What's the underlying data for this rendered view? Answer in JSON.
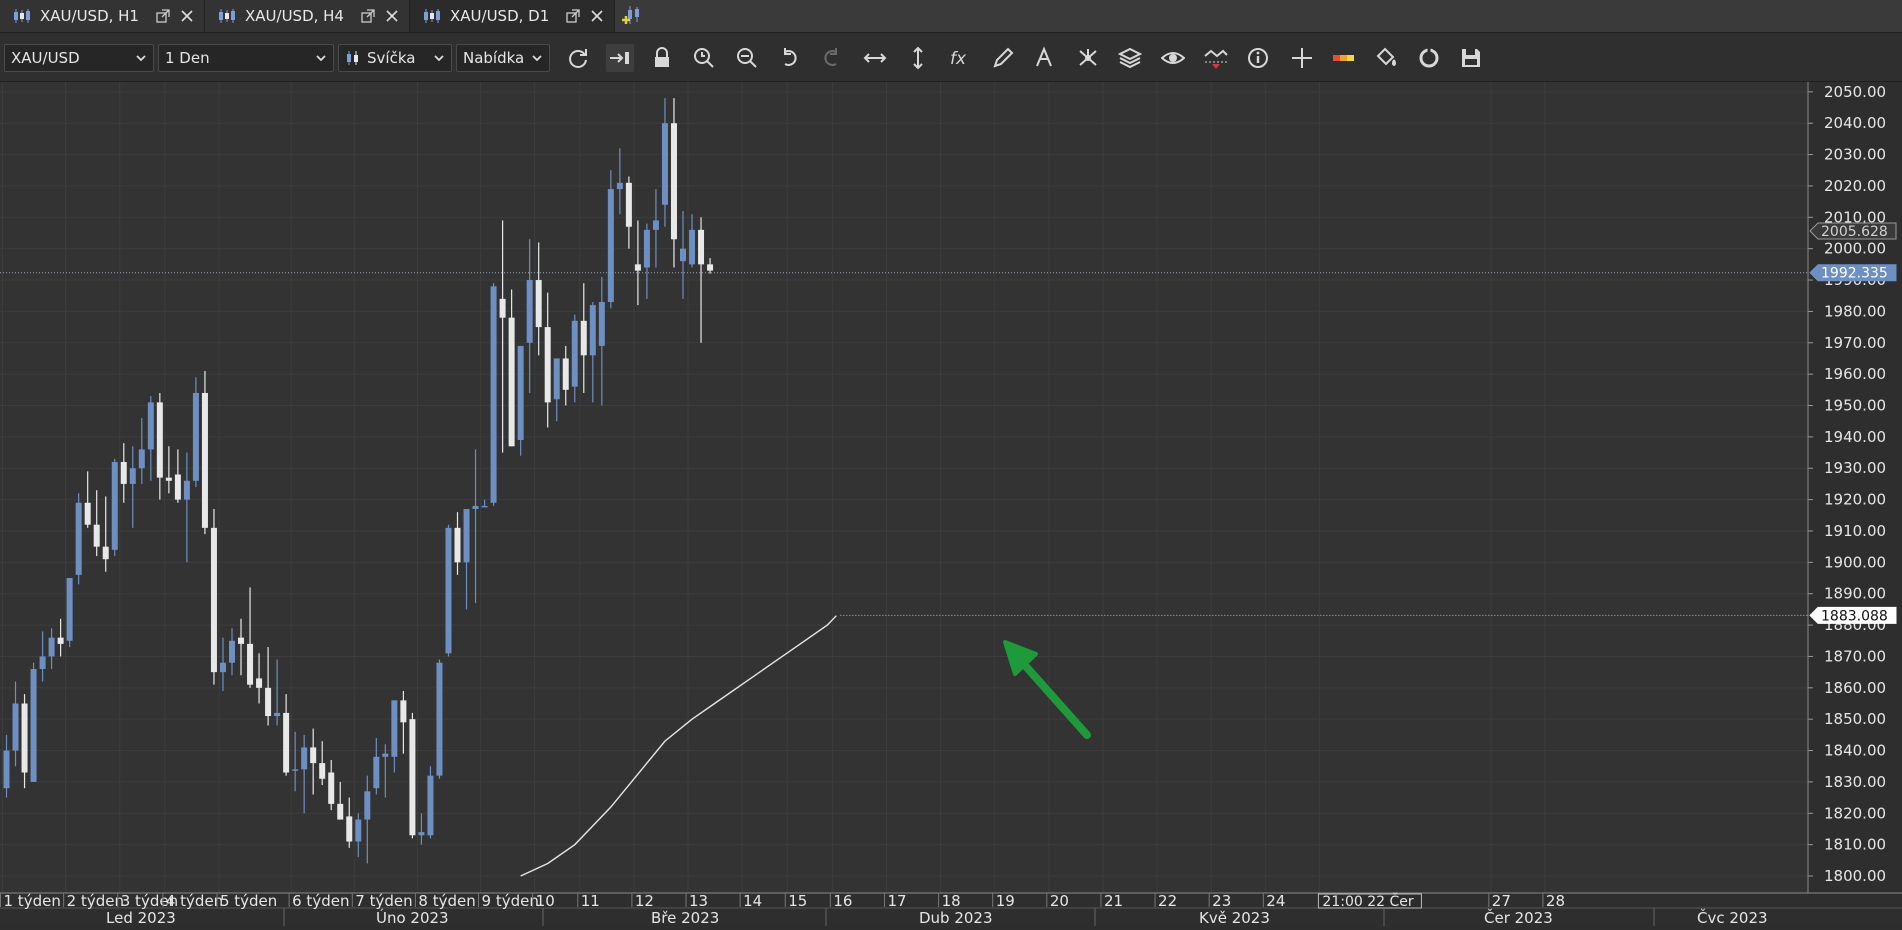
{
  "tabs": [
    {
      "label": "XAU/USD, H1",
      "active": false
    },
    {
      "label": "XAU/USD, H4",
      "active": false
    },
    {
      "label": "XAU/USD, D1",
      "active": true
    }
  ],
  "toolbar": {
    "instrument": "XAU/USD",
    "period": "1 Den",
    "chart_type": "Svíčka",
    "price_side": "Nabídka",
    "tools": [
      "refresh-icon",
      "shift-chart-icon",
      "lock-icon",
      "zoom-time-icon",
      "zoom-fit-icon",
      "undo-icon",
      "redo-icon",
      "horizontal-resize-icon",
      "vertical-resize-icon",
      "indicators-fx-icon",
      "drawing-pencil-icon",
      "text-tool-icon",
      "pattern-tool-icon",
      "layers-icon",
      "visibility-eye-icon",
      "strategy-icon",
      "info-icon",
      "crosshair-icon",
      "levels-icon",
      "paint-bucket-icon",
      "sync-icon",
      "save-icon"
    ]
  },
  "colors": {
    "background": "#333333",
    "bull_candle": "#6e8fc2",
    "bear_candle": "#e8e8e8",
    "grid": "#3d3d3d",
    "arrow": "#1f9a3a",
    "current_price_label": "#6e8fc2"
  },
  "chart_data": {
    "type": "candlestick",
    "instrument": "XAU/USD",
    "period": "D1",
    "y_axis_ticks": [
      "1800.00",
      "1810.00",
      "1820.00",
      "1830.00",
      "1840.00",
      "1850.00",
      "1860.00",
      "1870.00",
      "1880.00",
      "1890.00",
      "1900.00",
      "1910.00",
      "1920.00",
      "1930.00",
      "1940.00",
      "1950.00",
      "1960.00",
      "1970.00",
      "1980.00",
      "1990.00",
      "2000.00",
      "2010.00",
      "2020.00",
      "2030.00",
      "2040.00",
      "2050.00"
    ],
    "ylim": [
      1796.5,
      2052.5
    ],
    "price_labels": {
      "marker_1": "2005.628",
      "current_price": "1992.335",
      "line_end": "1883.088"
    },
    "x_axis_ticks": [
      "1 týden",
      "2 týden",
      "3 týden",
      "4 týden",
      "5 týden",
      "6 týden",
      "7 týden",
      "8 týden",
      "9 týden",
      "10",
      "11",
      "12",
      "13",
      "14",
      "15",
      "16",
      "17",
      "18",
      "19",
      "20",
      "21",
      "22",
      "23",
      "24",
      "21:00 22 Čer",
      "27",
      "28"
    ],
    "x_axis_months": [
      "Led 2023",
      "Úno 2023",
      "Bře 2023",
      "Dub 2023",
      "Kvě 2023",
      "Čer 2023",
      "Čvc 2023"
    ],
    "candles": [
      {
        "o": 1828,
        "h": 1845,
        "l": 1825,
        "c": 1840
      },
      {
        "o": 1840,
        "h": 1862,
        "l": 1835,
        "c": 1855
      },
      {
        "o": 1855,
        "h": 1858,
        "l": 1828,
        "c": 1833
      },
      {
        "o": 1830,
        "h": 1868,
        "l": 1830,
        "c": 1866
      },
      {
        "o": 1866,
        "h": 1878,
        "l": 1862,
        "c": 1870
      },
      {
        "o": 1870,
        "h": 1879,
        "l": 1866,
        "c": 1876
      },
      {
        "o": 1876,
        "h": 1882,
        "l": 1870,
        "c": 1874
      },
      {
        "o": 1875,
        "h": 1895,
        "l": 1873,
        "c": 1895
      },
      {
        "o": 1896,
        "h": 1922,
        "l": 1893,
        "c": 1919
      },
      {
        "o": 1919,
        "h": 1929,
        "l": 1911,
        "c": 1912
      },
      {
        "o": 1912,
        "h": 1923,
        "l": 1902,
        "c": 1905
      },
      {
        "o": 1905,
        "h": 1921,
        "l": 1897,
        "c": 1901
      },
      {
        "o": 1904,
        "h": 1933,
        "l": 1902,
        "c": 1932
      },
      {
        "o": 1932,
        "h": 1938,
        "l": 1919,
        "c": 1925
      },
      {
        "o": 1925,
        "h": 1937,
        "l": 1911,
        "c": 1930
      },
      {
        "o": 1930,
        "h": 1946,
        "l": 1925,
        "c": 1936
      },
      {
        "o": 1936,
        "h": 1953,
        "l": 1926,
        "c": 1951
      },
      {
        "o": 1951,
        "h": 1954,
        "l": 1920,
        "c": 1927
      },
      {
        "o": 1927,
        "h": 1937,
        "l": 1922,
        "c": 1926
      },
      {
        "o": 1928,
        "h": 1936,
        "l": 1919,
        "c": 1920
      },
      {
        "o": 1920,
        "h": 1935,
        "l": 1900,
        "c": 1926
      },
      {
        "o": 1926,
        "h": 1959,
        "l": 1924,
        "c": 1954
      },
      {
        "o": 1954,
        "h": 1961,
        "l": 1909,
        "c": 1911
      },
      {
        "o": 1911,
        "h": 1917,
        "l": 1861,
        "c": 1865
      },
      {
        "o": 1865,
        "h": 1876,
        "l": 1859,
        "c": 1868
      },
      {
        "o": 1868,
        "h": 1879,
        "l": 1864,
        "c": 1875
      },
      {
        "o": 1876,
        "h": 1882,
        "l": 1864,
        "c": 1874
      },
      {
        "o": 1874,
        "h": 1892,
        "l": 1860,
        "c": 1861
      },
      {
        "o": 1863,
        "h": 1871,
        "l": 1855,
        "c": 1860
      },
      {
        "o": 1860,
        "h": 1873,
        "l": 1848,
        "c": 1851
      },
      {
        "o": 1851,
        "h": 1869,
        "l": 1848,
        "c": 1852
      },
      {
        "o": 1852,
        "h": 1858,
        "l": 1832,
        "c": 1833
      },
      {
        "o": 1834,
        "h": 1846,
        "l": 1827,
        "c": 1834
      },
      {
        "o": 1834,
        "h": 1845,
        "l": 1820,
        "c": 1841
      },
      {
        "o": 1841,
        "h": 1847,
        "l": 1826,
        "c": 1836
      },
      {
        "o": 1836,
        "h": 1843,
        "l": 1829,
        "c": 1831
      },
      {
        "o": 1833,
        "h": 1837,
        "l": 1821,
        "c": 1823
      },
      {
        "o": 1823,
        "h": 1830,
        "l": 1818,
        "c": 1818
      },
      {
        "o": 1819,
        "h": 1825,
        "l": 1809,
        "c": 1811
      },
      {
        "o": 1811,
        "h": 1820,
        "l": 1806,
        "c": 1818
      },
      {
        "o": 1818,
        "h": 1832,
        "l": 1804,
        "c": 1827
      },
      {
        "o": 1828,
        "h": 1844,
        "l": 1826,
        "c": 1838
      },
      {
        "o": 1838,
        "h": 1842,
        "l": 1825,
        "c": 1839
      },
      {
        "o": 1838,
        "h": 1856,
        "l": 1833,
        "c": 1856
      },
      {
        "o": 1856,
        "h": 1859,
        "l": 1839,
        "c": 1849
      },
      {
        "o": 1850,
        "h": 1852,
        "l": 1812,
        "c": 1813
      },
      {
        "o": 1813,
        "h": 1820,
        "l": 1810,
        "c": 1814
      },
      {
        "o": 1813,
        "h": 1835,
        "l": 1812,
        "c": 1832
      },
      {
        "o": 1832,
        "h": 1869,
        "l": 1831,
        "c": 1868
      },
      {
        "o": 1871,
        "h": 1912,
        "l": 1870,
        "c": 1911
      },
      {
        "o": 1911,
        "h": 1916,
        "l": 1896,
        "c": 1900
      },
      {
        "o": 1900,
        "h": 1910,
        "l": 1885,
        "c": 1917
      },
      {
        "o": 1917,
        "h": 1936,
        "l": 1887,
        "c": 1918
      },
      {
        "o": 1918,
        "h": 1920,
        "l": 1918,
        "c": 1918
      },
      {
        "o": 1919,
        "h": 1989,
        "l": 1918,
        "c": 1988
      },
      {
        "o": 1984,
        "h": 2009,
        "l": 1935,
        "c": 1978
      },
      {
        "o": 1978,
        "h": 1987,
        "l": 1937,
        "c": 1937
      },
      {
        "o": 1939,
        "h": 1969,
        "l": 1934,
        "c": 1969
      },
      {
        "o": 1970,
        "h": 2003,
        "l": 1954,
        "c": 1990
      },
      {
        "o": 1990,
        "h": 2002,
        "l": 1966,
        "c": 1975
      },
      {
        "o": 1975,
        "h": 1986,
        "l": 1943,
        "c": 1951
      },
      {
        "o": 1952,
        "h": 1965,
        "l": 1945,
        "c": 1965
      },
      {
        "o": 1965,
        "h": 1969,
        "l": 1950,
        "c": 1955
      },
      {
        "o": 1956,
        "h": 1979,
        "l": 1951,
        "c": 1977
      },
      {
        "o": 1977,
        "h": 1989,
        "l": 1954,
        "c": 1966
      },
      {
        "o": 1966,
        "h": 1983,
        "l": 1951,
        "c": 1982
      },
      {
        "o": 1969,
        "h": 1991,
        "l": 1950,
        "c": 1983
      },
      {
        "o": 1983,
        "h": 2025,
        "l": 1981,
        "c": 2019
      },
      {
        "o": 2019,
        "h": 2032,
        "l": 2011,
        "c": 2021
      },
      {
        "o": 2021,
        "h": 2023,
        "l": 2000,
        "c": 2007
      },
      {
        "o": 1995,
        "h": 2009,
        "l": 1982,
        "c": 1993
      },
      {
        "o": 1994,
        "h": 2008,
        "l": 1984,
        "c": 2006
      },
      {
        "o": 2006,
        "h": 2019,
        "l": 1994,
        "c": 2009
      },
      {
        "o": 2014,
        "h": 2048,
        "l": 2007,
        "c": 2040
      },
      {
        "o": 2040,
        "h": 2048,
        "l": 1994,
        "c": 2003
      },
      {
        "o": 1996,
        "h": 2012,
        "l": 1984,
        "c": 2000
      },
      {
        "o": 1995,
        "h": 2011,
        "l": 1994,
        "c": 2006
      },
      {
        "o": 2006,
        "h": 2010,
        "l": 1970,
        "c": 1995
      },
      {
        "o": 1995,
        "h": 1997,
        "l": 1992,
        "c": 1993
      }
    ],
    "moving_average": [
      {
        "i": 57,
        "v": 1800
      },
      {
        "i": 60,
        "v": 1804
      },
      {
        "i": 63,
        "v": 1810
      },
      {
        "i": 65,
        "v": 1816
      },
      {
        "i": 67,
        "v": 1822
      },
      {
        "i": 69,
        "v": 1829
      },
      {
        "i": 71,
        "v": 1836
      },
      {
        "i": 73,
        "v": 1843
      },
      {
        "i": 76,
        "v": 1850
      },
      {
        "i": 79,
        "v": 1856
      },
      {
        "i": 82,
        "v": 1862
      },
      {
        "i": 85,
        "v": 1868
      },
      {
        "i": 88,
        "v": 1874
      },
      {
        "i": 91,
        "v": 1880
      },
      {
        "i": 92,
        "v": 1883
      }
    ]
  }
}
